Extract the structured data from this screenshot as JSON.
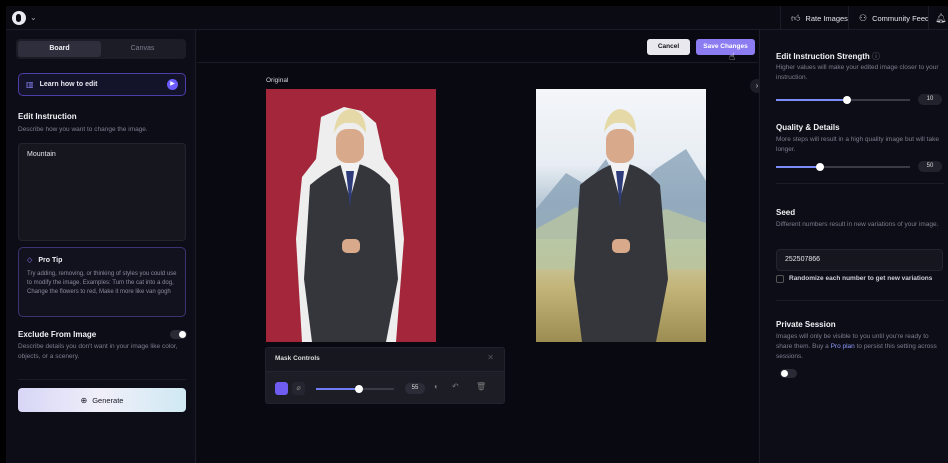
{
  "topbar": {
    "rate_images": "Rate Images",
    "community_feed": "Community Feed"
  },
  "left": {
    "tabs": [
      "Board",
      "Canvas"
    ],
    "learn": "Learn how to edit",
    "instruction_title": "Edit Instruction",
    "instruction_sub": "Describe how you want to change the image.",
    "instruction_value": "Mountain",
    "tip_title": "Pro Tip",
    "tip_body": "Try adding, removing, or thinking of styles you could use to modify the image. Examples: Turn the cat into a dog, Change the flowers to red, Make it more like van gogh",
    "exclude_title": "Exclude From Image",
    "exclude_sub": "Describe details you don't want in your image like color, objects, or a scenery.",
    "exclude_enabled": true,
    "generate": "Generate"
  },
  "center": {
    "cancel": "Cancel",
    "save": "Save Changes",
    "original_label": "Original",
    "mask": {
      "title": "Mask Controls",
      "value": "55",
      "level": 0.55
    }
  },
  "right": {
    "strength_title": "Edit Instruction Strength",
    "strength_sub": "Higher values will make your edited image closer to your instruction.",
    "strength_value": "10",
    "quality_title": "Quality & Details",
    "quality_sub": "More steps will result in a high quality image but will take longer.",
    "quality_value": "50",
    "seed_title": "Seed",
    "seed_sub": "Different numbers result in new variations of your image.",
    "seed_value": "252507866",
    "randomize_label": "Randomize each number to get new variations",
    "private_title": "Private Session",
    "private_sub_a": "Images will only be visible to you until you're ready to share them. Buy a",
    "private_link": "Pro plan",
    "private_sub_b": "to persist this setting across sessions.",
    "private_enabled": false
  },
  "colors": {
    "accent": "#8b7cf2",
    "original_bg": "#a3263a"
  }
}
